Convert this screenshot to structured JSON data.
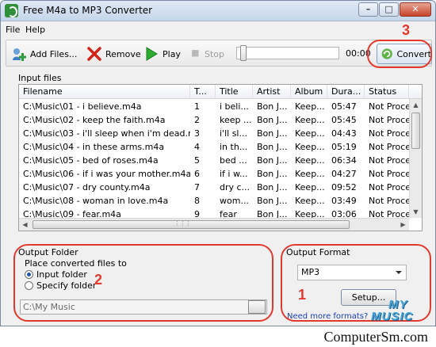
{
  "window": {
    "title": "Free M4a to MP3 Converter",
    "buttons": {
      "minimize_glyph": "–",
      "maximize_glyph": "□",
      "close_glyph": "✕"
    }
  },
  "menu": [
    {
      "label": "File"
    },
    {
      "label": "Help"
    }
  ],
  "toolbar": {
    "add_files": "Add Files...",
    "remove": "Remove",
    "play": "Play",
    "stop": "Stop",
    "time": "00:00",
    "convert": "Convert",
    "icons": {
      "add_files": "add-files-icon",
      "remove": "red-x-icon",
      "play": "play-icon",
      "stop": "stop-icon",
      "convert": "convert-icon"
    },
    "seek_progress": 0.0
  },
  "input_files": {
    "label": "Input files",
    "columns": [
      "Filename",
      "T...",
      "Title",
      "Artist",
      "Album",
      "Dura...",
      "Status"
    ],
    "rows": [
      [
        "C:\\Music\\01 - i believe.m4a",
        "1",
        "i beli...",
        "Bon J...",
        "Keep...",
        "05:47",
        "Not Proces"
      ],
      [
        "C:\\Music\\02 - keep the faith.m4a",
        "2",
        "keep ...",
        "Bon J...",
        "Keep...",
        "05:45",
        "Not Proces"
      ],
      [
        "C:\\Music\\03 - i'll sleep when i'm dead.m4a",
        "3",
        "i'll sl...",
        "Bon J...",
        "Keep...",
        "04:43",
        "Not Proces"
      ],
      [
        "C:\\Music\\04 - in these arms.m4a",
        "4",
        "in th...",
        "Bon J...",
        "Keep...",
        "05:19",
        "Not Proces"
      ],
      [
        "C:\\Music\\05 - bed of roses.m4a",
        "5",
        "bed ...",
        "Bon J...",
        "Keep...",
        "06:34",
        "Not Proces"
      ],
      [
        "C:\\Music\\06 - if i was your mother.m4a",
        "6",
        "if i w...",
        "Bon J...",
        "Keep...",
        "04:27",
        "Not Proces"
      ],
      [
        "C:\\Music\\07 - dry county.m4a",
        "7",
        "dry c...",
        "Bon J...",
        "Keep...",
        "09:52",
        "Not Proces"
      ],
      [
        "C:\\Music\\08 - woman in love.m4a",
        "8",
        "wom...",
        "Bon J...",
        "Keep...",
        "03:49",
        "Not Proces"
      ],
      [
        "C:\\Music\\09 - fear.m4a",
        "9",
        "fear",
        "Bon J...",
        "Keep...",
        "03:06",
        "Not Proces"
      ]
    ]
  },
  "output_folder": {
    "label": "Output Folder",
    "caption": "Place converted files to",
    "options": [
      {
        "label": "Input folder",
        "checked": true
      },
      {
        "label": "Specify folder",
        "checked": false
      }
    ],
    "path": "C:\\My Music"
  },
  "output_format": {
    "label": "Output Format",
    "selected": "MP3",
    "setup": "Setup...",
    "link": "Need more formats?"
  },
  "annotations": {
    "one": "1",
    "two": "2",
    "three": "3",
    "color": "#e23a2e"
  },
  "watermark": {
    "line1": "MY",
    "line2": "MUSIC"
  },
  "footer": {
    "site": "ComputerSm.com"
  }
}
